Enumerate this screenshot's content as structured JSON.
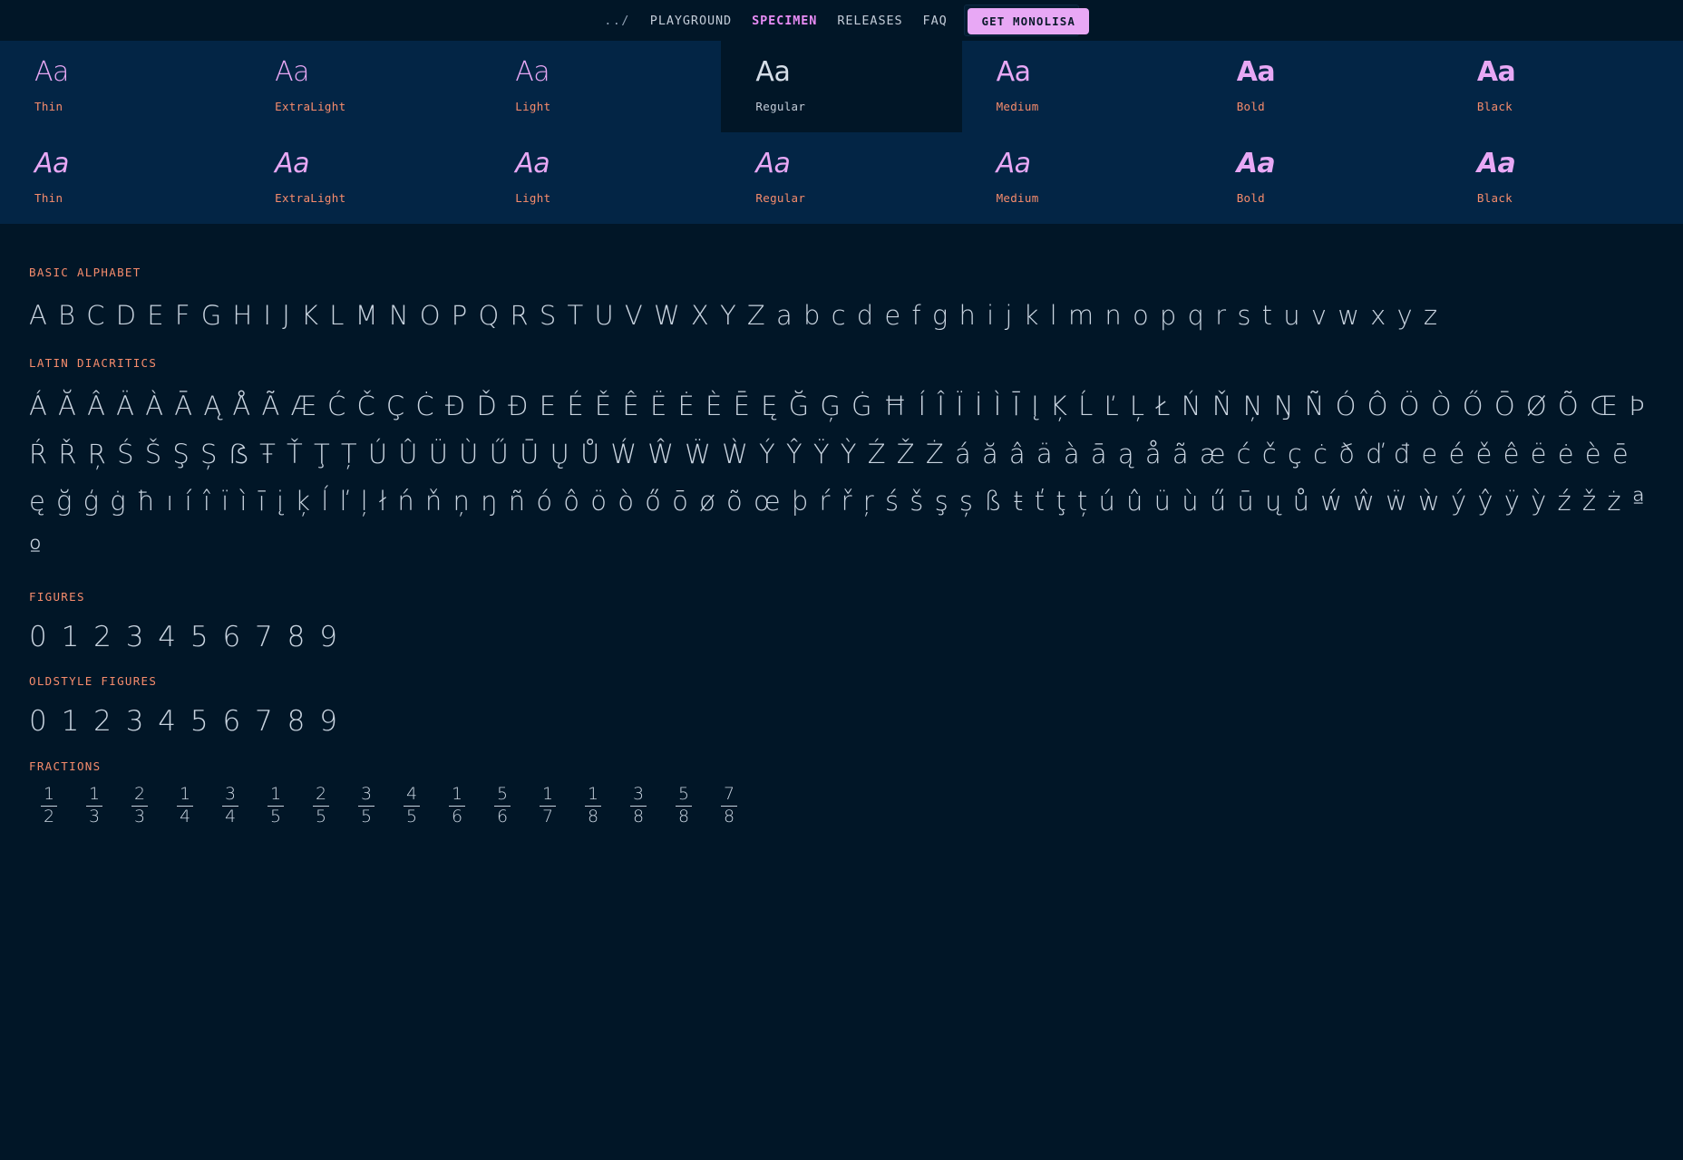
{
  "nav": {
    "links": [
      {
        "label": "../",
        "name": "nav-link-parent",
        "active": false,
        "dots": true
      },
      {
        "label": "PLAYGROUND",
        "name": "nav-link-playground",
        "active": false,
        "dots": false
      },
      {
        "label": "SPECIMEN",
        "name": "nav-link-specimen",
        "active": true,
        "dots": false
      },
      {
        "label": "RELEASES",
        "name": "nav-link-releases",
        "active": false,
        "dots": false
      },
      {
        "label": "FAQ",
        "name": "nav-link-faq",
        "active": false,
        "dots": false
      }
    ],
    "theme": {
      "name": "Night Owl",
      "icon": "half-circle-theme-icon"
    },
    "cta": "GET MONOLISA"
  },
  "colors": {
    "page_background": "#011627",
    "weight_panel_background": "#032545",
    "accent_pink": "#e8a8f5",
    "accent_orange": "#f78c6c",
    "text": "#c9d4e0"
  },
  "weights": {
    "sample_text": "Aa",
    "selected": "Regular",
    "upright": [
      {
        "label": "Thin",
        "class": "w-thin",
        "selected": false
      },
      {
        "label": "ExtraLight",
        "class": "w-extralight",
        "selected": false
      },
      {
        "label": "Light",
        "class": "w-light",
        "selected": false
      },
      {
        "label": "Regular",
        "class": "w-regular",
        "selected": true
      },
      {
        "label": "Medium",
        "class": "w-medium",
        "selected": false
      },
      {
        "label": "Bold",
        "class": "w-bold",
        "selected": false
      },
      {
        "label": "Black",
        "class": "w-black",
        "selected": false
      }
    ],
    "italic": [
      {
        "label": "Thin",
        "class": "w-thin",
        "selected": false
      },
      {
        "label": "ExtraLight",
        "class": "w-extralight",
        "selected": false
      },
      {
        "label": "Light",
        "class": "w-light",
        "selected": false
      },
      {
        "label": "Regular",
        "class": "w-regular",
        "selected": false
      },
      {
        "label": "Medium",
        "class": "w-medium",
        "selected": false
      },
      {
        "label": "Bold",
        "class": "w-bold",
        "selected": false
      },
      {
        "label": "Black",
        "class": "w-black",
        "selected": false
      }
    ]
  },
  "sections": {
    "basic_alphabet": {
      "title": "BASIC ALPHABET",
      "glyphs": "A B C D E F G H I J K L M N O P Q R S T U V W X Y Z a b c d e f g h i j k l m n o p q r s t u v w x y z"
    },
    "latin_diacritics": {
      "title": "LATIN DIACRITICS",
      "glyphs": "Á Ă Â Ä À Ā Ą Å Ã Æ Ć Č Ç Ċ Ð Ď Đ E É Ě Ê Ë Ė È Ē Ę Ğ Ģ Ġ Ħ Í Î Ï İ Ì Ī Į Ķ Ĺ Ľ Ļ Ł Ń Ň Ņ Ŋ Ñ Ó Ô Ö Ò Ő Ō Ø Õ Œ Þ Ŕ Ř Ŗ Ś Š Ş Ș ẞ Ŧ Ť Ţ Ț Ú Û Ü Ù Ű Ū Ų Ů Ẃ Ŵ Ẅ Ẁ Ý Ŷ Ÿ Ỳ Ź Ž Ż á ă â ä à ā ą å ã æ ć č ç ċ ð ď đ e é ě ê ë ė è ē ę ğ ģ ġ ħ ı í î ï ì ī į ķ ĺ ľ ļ ł ń ň ņ ŋ ñ ó ô ö ò ő ō ø õ œ þ ŕ ř ŗ ś š ş ș ß ŧ ť ţ ț ú û ü ù ű ū ų ů ẃ ŵ ẅ ẁ ý ŷ ÿ ỳ ź ž ż ª º"
    },
    "figures": {
      "title": "FIGURES",
      "glyphs": "0 1 2 3 4 5 6 7 8 9"
    },
    "oldstyle_figures": {
      "title": "OLDSTYLE FIGURES",
      "glyphs": "0 1 2 3 4 5 6 7 8 9"
    },
    "fractions": {
      "title": "FRACTIONS",
      "items": [
        {
          "num": "1",
          "den": "2"
        },
        {
          "num": "1",
          "den": "3"
        },
        {
          "num": "2",
          "den": "3"
        },
        {
          "num": "1",
          "den": "4"
        },
        {
          "num": "3",
          "den": "4"
        },
        {
          "num": "1",
          "den": "5"
        },
        {
          "num": "2",
          "den": "5"
        },
        {
          "num": "3",
          "den": "5"
        },
        {
          "num": "4",
          "den": "5"
        },
        {
          "num": "1",
          "den": "6"
        },
        {
          "num": "5",
          "den": "6"
        },
        {
          "num": "1",
          "den": "7"
        },
        {
          "num": "1",
          "den": "8"
        },
        {
          "num": "3",
          "den": "8"
        },
        {
          "num": "5",
          "den": "8"
        },
        {
          "num": "7",
          "den": "8"
        }
      ]
    }
  }
}
